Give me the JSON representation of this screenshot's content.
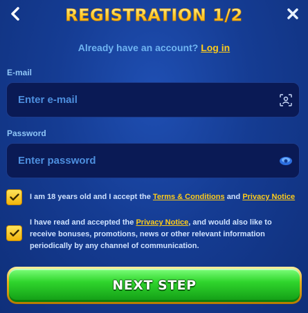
{
  "header": {
    "title": "REGISTRATION 1/2",
    "back_icon": "chevron-left-icon",
    "close_icon": "close-icon"
  },
  "login": {
    "prompt": "Already have an account?",
    "link_label": "Log in"
  },
  "email": {
    "label": "E-mail",
    "placeholder": "Enter e-mail",
    "value": "",
    "icon": "face-scan-icon"
  },
  "password": {
    "label": "Password",
    "placeholder": "Enter password",
    "value": "",
    "icon": "eye-icon"
  },
  "consent_age": {
    "checked": true,
    "text_before": "I am 18 years old and I accept the",
    "terms_link": "Terms & Conditions",
    "and": "and",
    "privacy_link": "Privacy Notice"
  },
  "consent_marketing": {
    "checked": true,
    "text_before": "I have read and accepted the",
    "privacy_link": "Privacy Notice",
    "text_after": ", and would also like to receive bonuses, promotions, news or other relevant information periodically by any channel of communication."
  },
  "next_button": {
    "label": "NEXT STEP"
  },
  "colors": {
    "background": "#153c93",
    "accent_yellow": "#ffcc1a",
    "button_green": "#2fd52c",
    "field_bg": "#0a1a55"
  }
}
